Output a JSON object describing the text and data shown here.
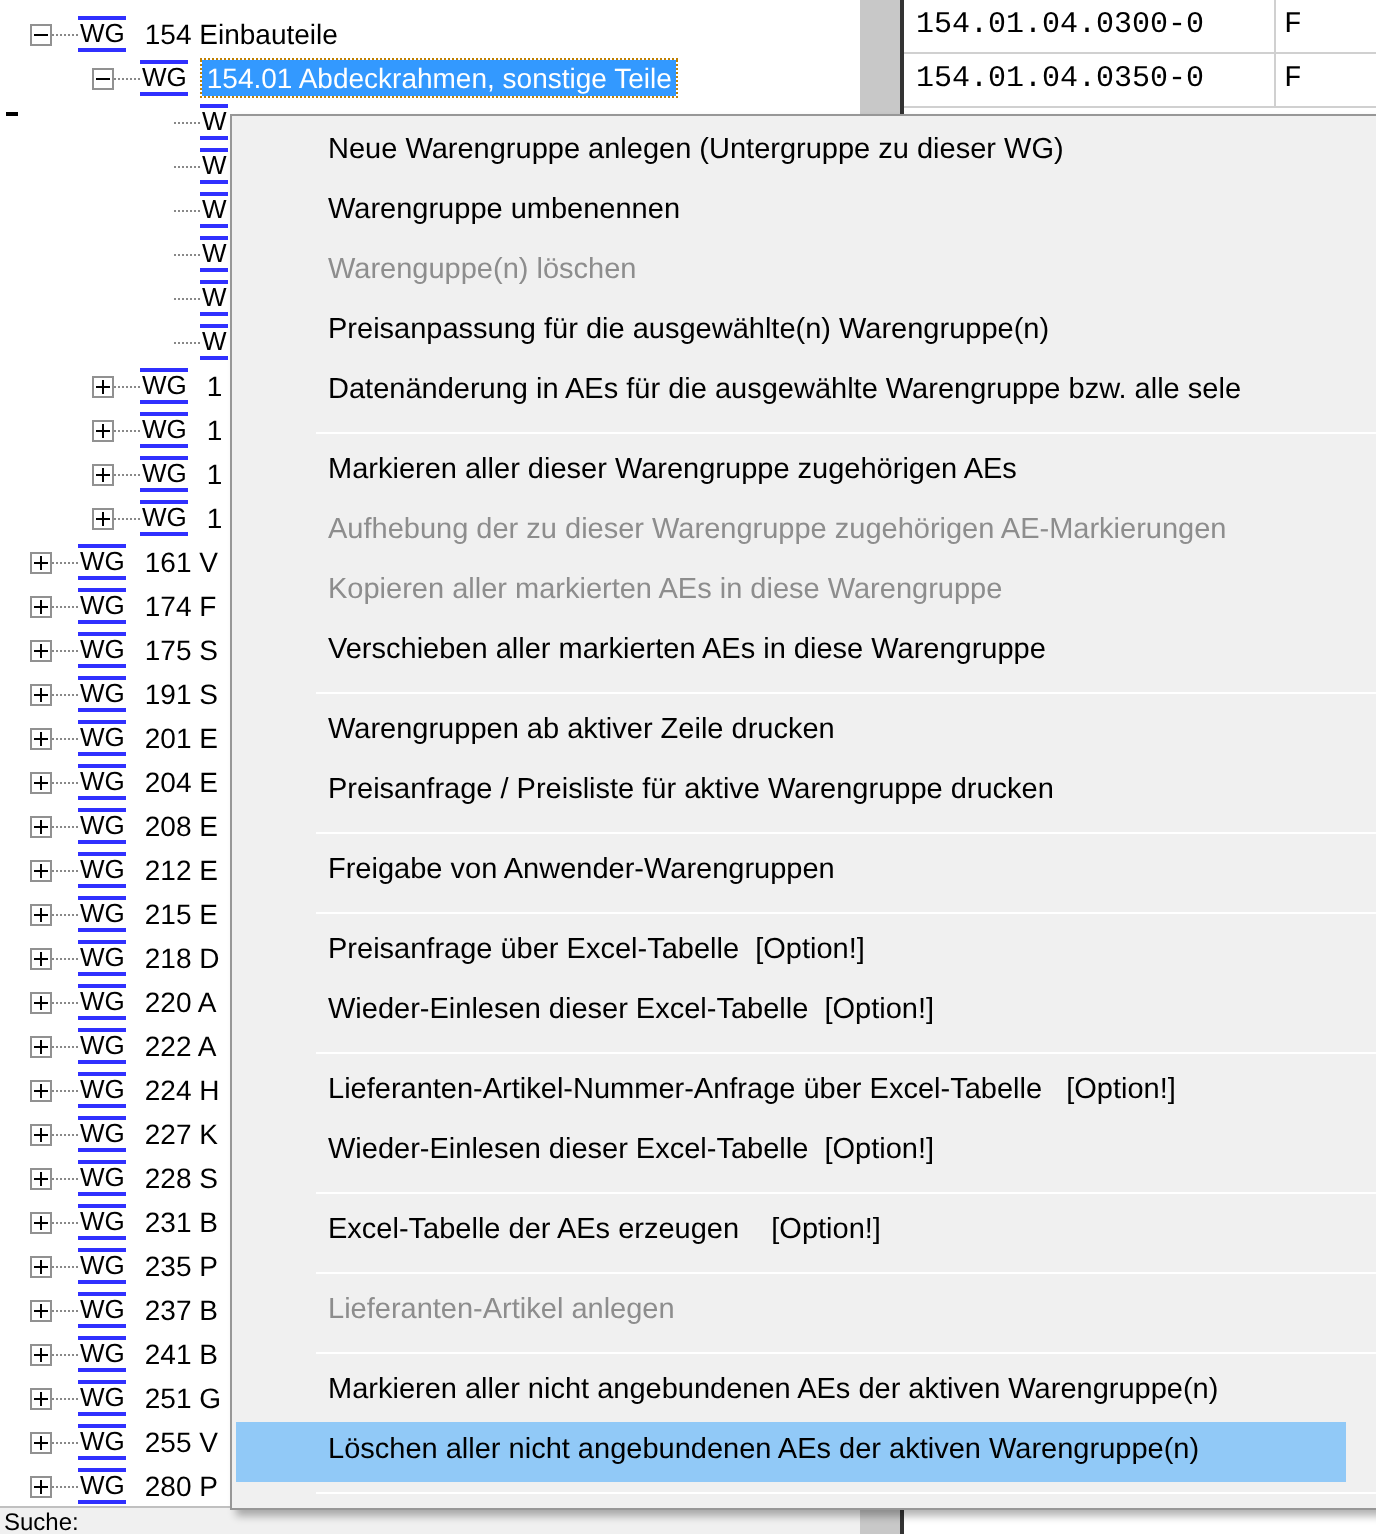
{
  "tree": [
    {
      "badge": "WG",
      "number": "154",
      "name": "Einbauteile",
      "expanded": true,
      "selected": false,
      "children": [
        {
          "badge": "WG",
          "number": "154.01",
          "name": "Abdeckrahmen, sonstige Teile",
          "expanded": true,
          "selected": true,
          "children": [
            {
              "kind": "leaf",
              "badge": "W",
              "selected": false
            },
            {
              "kind": "leaf",
              "badge": "W",
              "selected": false
            },
            {
              "kind": "leaf",
              "badge": "W",
              "selected": false
            },
            {
              "kind": "leaf",
              "badge": "W",
              "selected": false
            },
            {
              "kind": "leaf",
              "badge": "W",
              "selected": false
            },
            {
              "kind": "leaf",
              "badge": "W",
              "selected": false
            }
          ]
        },
        {
          "badge": "WG",
          "number": "1",
          "expanded": false,
          "selected": false
        },
        {
          "badge": "WG",
          "number": "1",
          "expanded": false,
          "selected": false
        },
        {
          "badge": "WG",
          "number": "1",
          "expanded": false,
          "selected": false
        },
        {
          "badge": "WG",
          "number": "1",
          "expanded": false,
          "selected": false
        }
      ]
    },
    {
      "badge": "WG",
      "number": "161",
      "name": "V",
      "expanded": false,
      "selected": false
    },
    {
      "badge": "WG",
      "number": "174",
      "name": "F",
      "expanded": false,
      "selected": false
    },
    {
      "badge": "WG",
      "number": "175",
      "name": "S",
      "expanded": false,
      "selected": false
    },
    {
      "badge": "WG",
      "number": "191",
      "name": "S",
      "expanded": false,
      "selected": false
    },
    {
      "badge": "WG",
      "number": "201",
      "name": "E",
      "expanded": false,
      "selected": false
    },
    {
      "badge": "WG",
      "number": "204",
      "name": "E",
      "expanded": false,
      "selected": false
    },
    {
      "badge": "WG",
      "number": "208",
      "name": "E",
      "expanded": false,
      "selected": false
    },
    {
      "badge": "WG",
      "number": "212",
      "name": "E",
      "expanded": false,
      "selected": false
    },
    {
      "badge": "WG",
      "number": "215",
      "name": "E",
      "expanded": false,
      "selected": false
    },
    {
      "badge": "WG",
      "number": "218",
      "name": "D",
      "expanded": false,
      "selected": false
    },
    {
      "badge": "WG",
      "number": "220",
      "name": "A",
      "expanded": false,
      "selected": false
    },
    {
      "badge": "WG",
      "number": "222",
      "name": "A",
      "expanded": false,
      "selected": false
    },
    {
      "badge": "WG",
      "number": "224",
      "name": "H",
      "expanded": false,
      "selected": false
    },
    {
      "badge": "WG",
      "number": "227",
      "name": "K",
      "expanded": false,
      "selected": false
    },
    {
      "badge": "WG",
      "number": "228",
      "name": "S",
      "expanded": false,
      "selected": false
    },
    {
      "badge": "WG",
      "number": "231",
      "name": "B",
      "expanded": false,
      "selected": false
    },
    {
      "badge": "WG",
      "number": "235",
      "name": "P",
      "expanded": false,
      "selected": false
    },
    {
      "badge": "WG",
      "number": "237",
      "name": "B",
      "expanded": false,
      "selected": false
    },
    {
      "badge": "WG",
      "number": "241",
      "name": "B",
      "expanded": false,
      "selected": false
    },
    {
      "badge": "WG",
      "number": "251",
      "name": "G",
      "expanded": false,
      "selected": false
    },
    {
      "badge": "WG",
      "number": "255",
      "name": "V",
      "expanded": false,
      "selected": false
    },
    {
      "badge": "WG",
      "number": "280",
      "name": "P",
      "expanded": false,
      "selected": false
    }
  ],
  "search": {
    "label": "Suche:"
  },
  "table": {
    "rows": [
      [
        "154.01.04.0300-0",
        "F"
      ],
      [
        "154.01.04.0350-0",
        "F"
      ]
    ]
  },
  "context_menu": {
    "items": [
      {
        "kind": "item",
        "label": "Neue Warengruppe anlegen (Untergruppe zu dieser WG)",
        "disabled": false,
        "selected": false
      },
      {
        "kind": "item",
        "label": "Warengruppe umbenennen",
        "disabled": false,
        "selected": false
      },
      {
        "kind": "item",
        "label": "Warenguppe(n) löschen",
        "disabled": true,
        "selected": false
      },
      {
        "kind": "item",
        "label": "Preisanpassung für die ausgewählte(n) Warengruppe(n)",
        "disabled": false,
        "selected": false
      },
      {
        "kind": "item",
        "label": "Datenänderung in AEs für die ausgewählte Warengruppe bzw. alle sele",
        "disabled": false,
        "selected": false
      },
      {
        "kind": "separator"
      },
      {
        "kind": "item",
        "label": "Markieren aller dieser Warengruppe zugehörigen AEs",
        "disabled": false,
        "selected": false
      },
      {
        "kind": "item",
        "label": "Aufhebung der zu dieser Warengruppe zugehörigen AE-Markierungen",
        "disabled": true,
        "selected": false
      },
      {
        "kind": "item",
        "label": "Kopieren aller markierten AEs in diese Warengruppe",
        "disabled": true,
        "selected": false
      },
      {
        "kind": "item",
        "label": "Verschieben aller markierten AEs in diese Warengruppe",
        "disabled": false,
        "selected": false
      },
      {
        "kind": "separator"
      },
      {
        "kind": "item",
        "label": "Warengruppen ab aktiver Zeile drucken",
        "disabled": false,
        "selected": false
      },
      {
        "kind": "item",
        "label": "Preisanfrage / Preisliste für aktive Warengruppe drucken",
        "disabled": false,
        "selected": false
      },
      {
        "kind": "separator"
      },
      {
        "kind": "item",
        "label": "Freigabe von Anwender-Warengruppen",
        "disabled": false,
        "selected": false
      },
      {
        "kind": "separator"
      },
      {
        "kind": "item",
        "label": "Preisanfrage über Excel-Tabelle  [Option!]",
        "disabled": false,
        "selected": false
      },
      {
        "kind": "item",
        "label": "Wieder-Einlesen dieser Excel-Tabelle  [Option!]",
        "disabled": false,
        "selected": false
      },
      {
        "kind": "separator"
      },
      {
        "kind": "item",
        "label": "Lieferanten-Artikel-Nummer-Anfrage über Excel-Tabelle   [Option!]",
        "disabled": false,
        "selected": false
      },
      {
        "kind": "item",
        "label": "Wieder-Einlesen dieser Excel-Tabelle  [Option!]",
        "disabled": false,
        "selected": false
      },
      {
        "kind": "separator"
      },
      {
        "kind": "item",
        "label": "Excel-Tabelle der AEs erzeugen    [Option!]",
        "disabled": false,
        "selected": false
      },
      {
        "kind": "separator"
      },
      {
        "kind": "item",
        "label": "Lieferanten-Artikel anlegen",
        "disabled": true,
        "selected": false
      },
      {
        "kind": "separator"
      },
      {
        "kind": "item",
        "label": "Markieren aller nicht angebundenen AEs der aktiven Warengruppe(n)",
        "disabled": false,
        "selected": false
      },
      {
        "kind": "item",
        "label": "Löschen aller nicht angebundenen AEs der aktiven Warengruppe(n)",
        "disabled": false,
        "selected": true
      },
      {
        "kind": "separator"
      }
    ]
  }
}
